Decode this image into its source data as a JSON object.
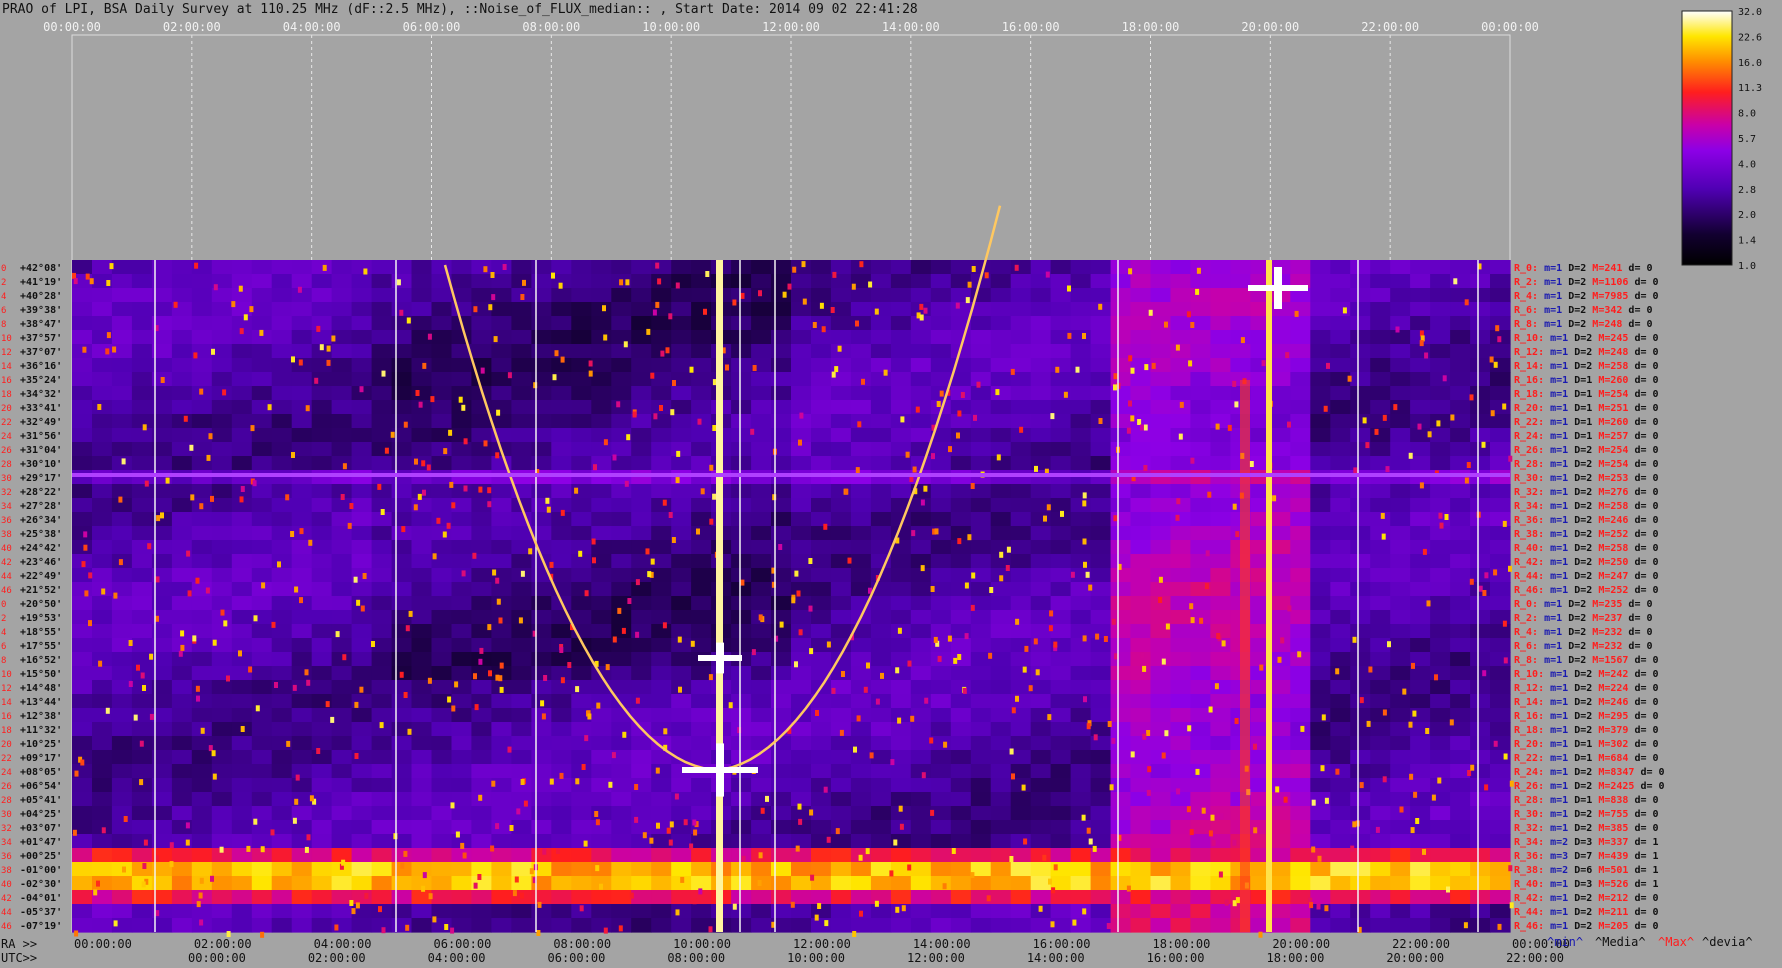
{
  "title": "PRAO of LPI, BSA Daily Survey at 110.25 MHz (dF::2.5 MHz), ::Noise_of_FLUX_median:: , Start Date: 2014 09 02 22:41:28",
  "colors": {
    "background": "#a4a4a4",
    "text": "#111111",
    "label_red": "#ff1e1e",
    "label_blue": "#1a1ab0"
  },
  "chart_data": {
    "type": "heatmap",
    "colormap": "black-purple-red-yellow-white",
    "top_axis_ticks": [
      "00:00:00",
      "02:00:00",
      "04:00:00",
      "06:00:00",
      "08:00:00",
      "10:00:00",
      "12:00:00",
      "14:00:00",
      "16:00:00",
      "18:00:00",
      "20:00:00",
      "22:00:00",
      "00:00:00"
    ],
    "ra_axis": {
      "label": "RA >>",
      "ticks": [
        "00:00:00",
        "02:00:00",
        "04:00:00",
        "06:00:00",
        "08:00:00",
        "10:00:00",
        "12:00:00",
        "14:00:00",
        "16:00:00",
        "18:00:00",
        "20:00:00",
        "22:00:00",
        "00:00:00"
      ]
    },
    "utc_axis": {
      "label": "UTC>>",
      "ticks": [
        "00:00:00",
        "02:00:00",
        "04:00:00",
        "06:00:00",
        "08:00:00",
        "10:00:00",
        "12:00:00",
        "14:00:00",
        "16:00:00",
        "18:00:00",
        "20:00:00",
        "22:00:00"
      ]
    },
    "declinations": [
      "+42°08'",
      "+41°19'",
      "+40°28'",
      "+39°38'",
      "+38°47'",
      "+37°57'",
      "+37°07'",
      "+36°16'",
      "+35°24'",
      "+34°32'",
      "+33°41'",
      "+32°49'",
      "+31°56'",
      "+31°04'",
      "+30°10'",
      "+29°17'",
      "+28°22'",
      "+27°28'",
      "+26°34'",
      "+25°38'",
      "+24°42'",
      "+23°46'",
      "+22°49'",
      "+21°52'",
      "+20°50'",
      "+19°53'",
      "+18°55'",
      "+17°55'",
      "+16°52'",
      "+15°50'",
      "+14°48'",
      "+13°44'",
      "+12°38'",
      "+11°32'",
      "+10°25'",
      "+09°17'",
      "+08°05'",
      "+06°54'",
      "+05°41'",
      "+04°25'",
      "+03°07'",
      "+01°47'",
      "+00°25'",
      "-01°00'",
      "-02°30'",
      "-04°01'",
      "-05°37'",
      "-07°19'"
    ],
    "beams": [
      "0",
      "2",
      "4",
      "6",
      "8",
      "10",
      "12",
      "14",
      "16",
      "18",
      "20",
      "22",
      "24",
      "26",
      "28",
      "30",
      "32",
      "34",
      "36",
      "38",
      "40",
      "42",
      "44",
      "46",
      "0",
      "2",
      "4",
      "6",
      "8",
      "10",
      "12",
      "14",
      "16",
      "18",
      "20",
      "22",
      "24",
      "26",
      "28",
      "30",
      "32",
      "34",
      "36",
      "38",
      "40",
      "42",
      "44",
      "46"
    ],
    "row_stats": [
      {
        "r": "R_0:",
        "m": "m=1",
        "d": "D=2",
        "M": "M=241",
        "dv": "d= 0"
      },
      {
        "r": "R_2:",
        "m": "m=1",
        "d": "D=2",
        "M": "M=1106",
        "dv": "d= 0"
      },
      {
        "r": "R_4:",
        "m": "m=1",
        "d": "D=2",
        "M": "M=7985",
        "dv": "d= 0"
      },
      {
        "r": "R_6:",
        "m": "m=1",
        "d": "D=2",
        "M": "M=342",
        "dv": "d= 0"
      },
      {
        "r": "R_8:",
        "m": "m=1",
        "d": "D=2",
        "M": "M=248",
        "dv": "d= 0"
      },
      {
        "r": "R_10:",
        "m": "m=1",
        "d": "D=2",
        "M": "M=245",
        "dv": "d= 0"
      },
      {
        "r": "R_12:",
        "m": "m=1",
        "d": "D=2",
        "M": "M=248",
        "dv": "d= 0"
      },
      {
        "r": "R_14:",
        "m": "m=1",
        "d": "D=2",
        "M": "M=258",
        "dv": "d= 0"
      },
      {
        "r": "R_16:",
        "m": "m=1",
        "d": "D=1",
        "M": "M=260",
        "dv": "d= 0"
      },
      {
        "r": "R_18:",
        "m": "m=1",
        "d": "D=1",
        "M": "M=254",
        "dv": "d= 0"
      },
      {
        "r": "R_20:",
        "m": "m=1",
        "d": "D=1",
        "M": "M=251",
        "dv": "d= 0"
      },
      {
        "r": "R_22:",
        "m": "m=1",
        "d": "D=1",
        "M": "M=260",
        "dv": "d= 0"
      },
      {
        "r": "R_24:",
        "m": "m=1",
        "d": "D=1",
        "M": "M=257",
        "dv": "d= 0"
      },
      {
        "r": "R_26:",
        "m": "m=1",
        "d": "D=2",
        "M": "M=254",
        "dv": "d= 0"
      },
      {
        "r": "R_28:",
        "m": "m=1",
        "d": "D=2",
        "M": "M=254",
        "dv": "d= 0"
      },
      {
        "r": "R_30:",
        "m": "m=1",
        "d": "D=2",
        "M": "M=253",
        "dv": "d= 0"
      },
      {
        "r": "R_32:",
        "m": "m=1",
        "d": "D=2",
        "M": "M=276",
        "dv": "d= 0"
      },
      {
        "r": "R_34:",
        "m": "m=1",
        "d": "D=2",
        "M": "M=258",
        "dv": "d= 0"
      },
      {
        "r": "R_36:",
        "m": "m=1",
        "d": "D=2",
        "M": "M=246",
        "dv": "d= 0"
      },
      {
        "r": "R_38:",
        "m": "m=1",
        "d": "D=2",
        "M": "M=252",
        "dv": "d= 0"
      },
      {
        "r": "R_40:",
        "m": "m=1",
        "d": "D=2",
        "M": "M=258",
        "dv": "d= 0"
      },
      {
        "r": "R_42:",
        "m": "m=1",
        "d": "D=2",
        "M": "M=250",
        "dv": "d= 0"
      },
      {
        "r": "R_44:",
        "m": "m=1",
        "d": "D=2",
        "M": "M=247",
        "dv": "d= 0"
      },
      {
        "r": "R_46:",
        "m": "m=1",
        "d": "D=2",
        "M": "M=252",
        "dv": "d= 0"
      },
      {
        "r": "R_0:",
        "m": "m=1",
        "d": "D=2",
        "M": "M=235",
        "dv": "d= 0"
      },
      {
        "r": "R_2:",
        "m": "m=1",
        "d": "D=2",
        "M": "M=237",
        "dv": "d= 0"
      },
      {
        "r": "R_4:",
        "m": "m=1",
        "d": "D=2",
        "M": "M=232",
        "dv": "d= 0"
      },
      {
        "r": "R_6:",
        "m": "m=1",
        "d": "D=2",
        "M": "M=232",
        "dv": "d= 0"
      },
      {
        "r": "R_8:",
        "m": "m=1",
        "d": "D=2",
        "M": "M=1567",
        "dv": "d= 0"
      },
      {
        "r": "R_10:",
        "m": "m=1",
        "d": "D=2",
        "M": "M=242",
        "dv": "d= 0"
      },
      {
        "r": "R_12:",
        "m": "m=1",
        "d": "D=2",
        "M": "M=224",
        "dv": "d= 0"
      },
      {
        "r": "R_14:",
        "m": "m=1",
        "d": "D=2",
        "M": "M=246",
        "dv": "d= 0"
      },
      {
        "r": "R_16:",
        "m": "m=1",
        "d": "D=2",
        "M": "M=295",
        "dv": "d= 0"
      },
      {
        "r": "R_18:",
        "m": "m=1",
        "d": "D=2",
        "M": "M=379",
        "dv": "d= 0"
      },
      {
        "r": "R_20:",
        "m": "m=1",
        "d": "D=1",
        "M": "M=302",
        "dv": "d= 0"
      },
      {
        "r": "R_22:",
        "m": "m=1",
        "d": "D=1",
        "M": "M=684",
        "dv": "d= 0"
      },
      {
        "r": "R_24:",
        "m": "m=1",
        "d": "D=2",
        "M": "M=8347",
        "dv": "d= 0"
      },
      {
        "r": "R_26:",
        "m": "m=1",
        "d": "D=2",
        "M": "M=2425",
        "dv": "d= 0"
      },
      {
        "r": "R_28:",
        "m": "m=1",
        "d": "D=1",
        "M": "M=838",
        "dv": "d= 0"
      },
      {
        "r": "R_30:",
        "m": "m=1",
        "d": "D=2",
        "M": "M=755",
        "dv": "d= 0"
      },
      {
        "r": "R_32:",
        "m": "m=1",
        "d": "D=2",
        "M": "M=385",
        "dv": "d= 0"
      },
      {
        "r": "R_34:",
        "m": "m=2",
        "d": "D=3",
        "M": "M=337",
        "dv": "d= 1"
      },
      {
        "r": "R_36:",
        "m": "m=3",
        "d": "D=7",
        "M": "M=439",
        "dv": "d= 1"
      },
      {
        "r": "R_38:",
        "m": "m=2",
        "d": "D=6",
        "M": "M=501",
        "dv": "d= 1"
      },
      {
        "r": "R_40:",
        "m": "m=1",
        "d": "D=3",
        "M": "M=526",
        "dv": "d= 1"
      },
      {
        "r": "R_42:",
        "m": "m=1",
        "d": "D=2",
        "M": "M=212",
        "dv": "d= 0"
      },
      {
        "r": "R_44:",
        "m": "m=1",
        "d": "D=2",
        "M": "M=211",
        "dv": "d= 0"
      },
      {
        "r": "R_46:",
        "m": "m=1",
        "d": "D=2",
        "M": "M=205",
        "dv": "d= 0"
      }
    ],
    "footer_legend": {
      "min": "^min^",
      "median": "^Media^",
      "max": "^Max^",
      "dev": "^devia^"
    },
    "colorbar": {
      "ticks": [
        "32.0",
        "22.6",
        "16.0",
        "11.3",
        "8.0",
        "5.7",
        "4.0",
        "2.8",
        "2.0",
        "1.4",
        "1.0"
      ],
      "scale": "log"
    }
  }
}
